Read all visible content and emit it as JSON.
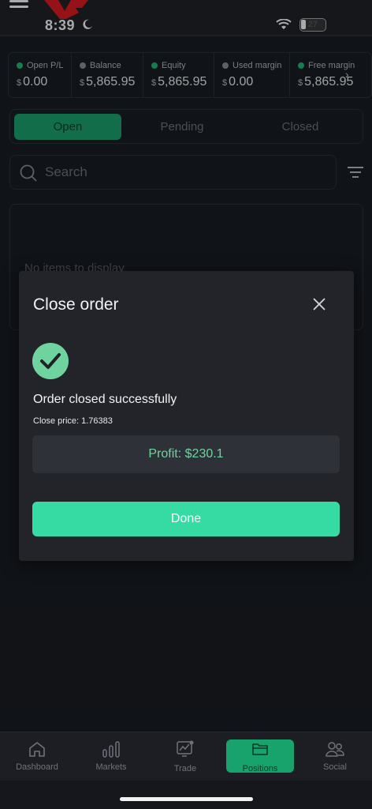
{
  "status_bar": {
    "time": "8:39",
    "battery": "27"
  },
  "metrics": [
    {
      "label": "Open P/L",
      "currency": "$",
      "value": "0.00",
      "dot": "green"
    },
    {
      "label": "Balance",
      "currency": "$",
      "value": "5,865.95",
      "dot": "grey"
    },
    {
      "label": "Equity",
      "currency": "$",
      "value": "5,865.95",
      "dot": "green"
    },
    {
      "label": "Used margin",
      "currency": "$",
      "value": "0.00",
      "dot": "grey"
    },
    {
      "label": "Free margin",
      "currency": "$",
      "value": "5,865.95",
      "dot": "green"
    }
  ],
  "tabs": {
    "open": "Open",
    "pending": "Pending",
    "closed": "Closed"
  },
  "search": {
    "placeholder": "Search"
  },
  "list": {
    "empty_text": "No items to display"
  },
  "modal": {
    "title": "Close order",
    "success_message": "Order closed successfully",
    "close_price": "Close price: 1.76383",
    "profit": "Profit: $230.1",
    "done_label": "Done"
  },
  "nav": {
    "dashboard": "Dashboard",
    "markets": "Markets",
    "trade": "Trade",
    "positions": "Positions",
    "social": "Social"
  },
  "colors": {
    "accent_green": "#17a36b",
    "success_green": "#6fd3a0",
    "done_button": "#36dba3",
    "background": "#15171c"
  }
}
